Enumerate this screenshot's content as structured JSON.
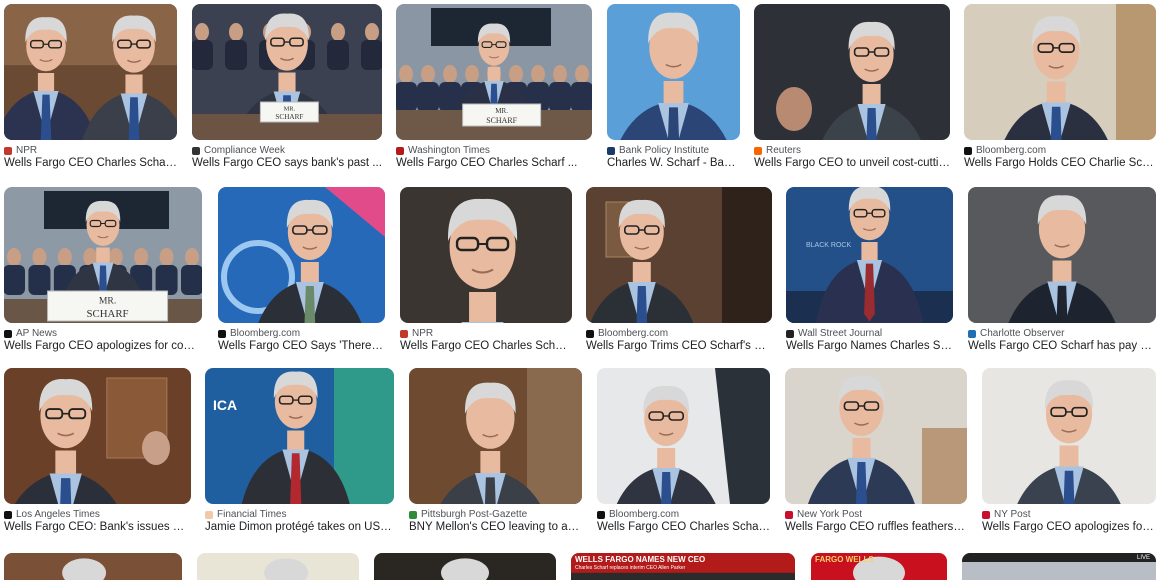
{
  "results": [
    {
      "source": "NPR",
      "title": "Wells Fargo CEO Charles Scharf ...",
      "fav": "npr-favicon",
      "favColor": "#c0392b"
    },
    {
      "source": "Compliance Week",
      "title": "Wells Fargo CEO says bank's past ...",
      "fav": "compliance-week-favicon",
      "favColor": "#333333"
    },
    {
      "source": "Washington Times",
      "title": "Wells Fargo CEO Charles Scharf ...",
      "fav": "washington-times-favicon",
      "favColor": "#b31b1b"
    },
    {
      "source": "Bank Policy Institute",
      "title": "Charles W. Scharf - Bank...",
      "fav": "bank-policy-institute-favicon",
      "favColor": "#1a3a6b"
    },
    {
      "source": "Reuters",
      "title": "Wells Fargo CEO to unveil cost-cutting...",
      "fav": "reuters-favicon",
      "favColor": "#fa6400"
    },
    {
      "source": "Bloomberg.com",
      "title": "Wells Fargo Holds CEO Charlie Schar...",
      "fav": "bloomberg-favicon",
      "favColor": "#111111"
    },
    {
      "source": "AP News",
      "title": "Wells Fargo CEO apologizes for comm...",
      "fav": "ap-news-favicon",
      "favColor": "#111111"
    },
    {
      "source": "Bloomberg.com",
      "title": "Wells Fargo CEO Says 'There Wil...",
      "fav": "bloomberg-favicon",
      "favColor": "#111111"
    },
    {
      "source": "NPR",
      "title": "Wells Fargo CEO Charles Scharf ...",
      "fav": "npr-favicon",
      "favColor": "#c0392b"
    },
    {
      "source": "Bloomberg.com",
      "title": "Wells Fargo Trims CEO Scharf's Pay...",
      "fav": "bloomberg-favicon",
      "favColor": "#111111"
    },
    {
      "source": "Wall Street Journal",
      "title": "Wells Fargo Names Charles Sch...",
      "fav": "wsj-favicon",
      "favColor": "#222222"
    },
    {
      "source": "Charlotte Observer",
      "title": "Wells Fargo CEO Scharf has pay cut ...",
      "fav": "charlotte-observer-favicon",
      "favColor": "#1f6fb2"
    },
    {
      "source": "Los Angeles Times",
      "title": "Wells Fargo CEO: Bank's issues won'...",
      "fav": "la-times-favicon",
      "favColor": "#111111"
    },
    {
      "source": "Financial Times",
      "title": "Jamie Dimon protégé takes on US b...",
      "fav": "financial-times-favicon",
      "favColor": "#f2c9a8"
    },
    {
      "source": "Pittsburgh Post-Gazette",
      "title": "BNY Mellon's CEO leaving to atte...",
      "fav": "post-gazette-favicon",
      "favColor": "#2e8b3a"
    },
    {
      "source": "Bloomberg.com",
      "title": "Wells Fargo CEO Charles Scharf ...",
      "fav": "bloomberg-favicon",
      "favColor": "#111111"
    },
    {
      "source": "New York Post",
      "title": "Wells Fargo CEO ruffles feathers w...",
      "fav": "new-york-post-favicon",
      "favColor": "#c8102e"
    },
    {
      "source": "NY Post",
      "title": "Wells Fargo CEO apologizes for 'li...",
      "fav": "new-york-post-favicon",
      "favColor": "#c8102e"
    }
  ],
  "placards": {
    "p1": "MR.\nSCHARF",
    "p2": "MR.\nSCHARF",
    "p3": "MR.\nSCHARF"
  },
  "partial": {
    "banner_title": "WELLS FARGO NAMES NEW CEO",
    "banner_sub": "Charles Scharf replaces interim CEO Allen Parker",
    "red_text": "FARGO   WELLS",
    "live": "LIVE"
  },
  "colors": {
    "hair": "#d8d8d8",
    "skin": "#e8bba0",
    "suit": "#2a3346",
    "shirt": "#a9c3e0",
    "tie_blue": "#2b4f8e",
    "tie_red": "#9a2b30"
  }
}
